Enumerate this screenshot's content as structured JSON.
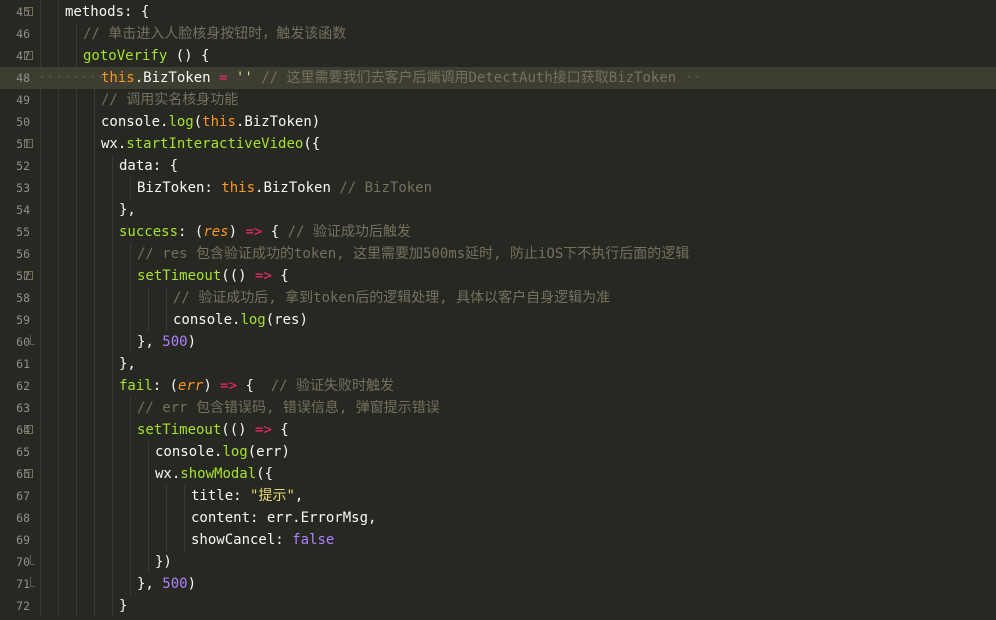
{
  "editor": {
    "theme": "monokai",
    "colors": {
      "background": "#272822",
      "comment": "#75715e",
      "keyword": "#f92672",
      "function": "#a6e22e",
      "string": "#e6db74",
      "number": "#ae81ff",
      "param": "#fd971f"
    },
    "active_line_index": 3,
    "lines": [
      {
        "num": "45",
        "indent": 2,
        "fold": "open",
        "tokens": [
          [
            "pl",
            "methods: {"
          ]
        ]
      },
      {
        "num": "46",
        "indent": 3,
        "tokens": [
          [
            "cm",
            "// 单击进入人脸核身按钮时，触发该函数"
          ]
        ]
      },
      {
        "num": "47",
        "indent": 3,
        "fold": "open",
        "tokens": [
          [
            "fn",
            "gotoVerify"
          ],
          [
            "pl",
            " () {"
          ]
        ]
      },
      {
        "num": "48",
        "indent": 4,
        "dots": "········",
        "tokens": [
          [
            "cs",
            "this"
          ],
          [
            "pl",
            ".BizToken "
          ],
          [
            "kw",
            "="
          ],
          [
            "pl",
            " "
          ],
          [
            "st",
            "''"
          ],
          [
            "pl",
            " "
          ],
          [
            "cm",
            "// 这里需要我们去客户后端调用DetectAuth接口获取BizToken"
          ]
        ],
        "trailing": " ··"
      },
      {
        "num": "49",
        "indent": 4,
        "tokens": [
          [
            "cm",
            "// 调用实名核身功能"
          ]
        ]
      },
      {
        "num": "50",
        "indent": 4,
        "tokens": [
          [
            "pl",
            "console."
          ],
          [
            "fn",
            "log"
          ],
          [
            "pl",
            "("
          ],
          [
            "cs",
            "this"
          ],
          [
            "pl",
            ".BizToken)"
          ]
        ]
      },
      {
        "num": "51",
        "indent": 4,
        "fold": "open",
        "tokens": [
          [
            "pl",
            "wx."
          ],
          [
            "fn",
            "startInteractiveVideo"
          ],
          [
            "pl",
            "({"
          ]
        ]
      },
      {
        "num": "52",
        "indent": 5,
        "tokens": [
          [
            "pl",
            "data: {"
          ]
        ]
      },
      {
        "num": "53",
        "indent": 6,
        "tokens": [
          [
            "pl",
            "BizToken: "
          ],
          [
            "cs",
            "this"
          ],
          [
            "pl",
            ".BizToken "
          ],
          [
            "cm",
            "// BizToken"
          ]
        ]
      },
      {
        "num": "54",
        "indent": 5,
        "tokens": [
          [
            "pl",
            "},"
          ]
        ]
      },
      {
        "num": "55",
        "indent": 5,
        "tokens": [
          [
            "fn",
            "success"
          ],
          [
            "pl",
            ": ("
          ],
          [
            "pm",
            "res"
          ],
          [
            "pl",
            ") "
          ],
          [
            "kw",
            "=>"
          ],
          [
            "pl",
            " { "
          ],
          [
            "cm",
            "// 验证成功后触发"
          ]
        ]
      },
      {
        "num": "56",
        "indent": 6,
        "tokens": [
          [
            "cm",
            "// res 包含验证成功的token, 这里需要加500ms延时, 防止iOS下不执行后面的逻辑"
          ]
        ]
      },
      {
        "num": "57",
        "indent": 6,
        "fold": "open",
        "tokens": [
          [
            "fn",
            "setTimeout"
          ],
          [
            "pl",
            "(() "
          ],
          [
            "kw",
            "=>"
          ],
          [
            "pl",
            " {"
          ]
        ]
      },
      {
        "num": "58",
        "indent": 8,
        "tokens": [
          [
            "cm",
            "// 验证成功后, 拿到token后的逻辑处理, 具体以客户自身逻辑为准"
          ]
        ]
      },
      {
        "num": "59",
        "indent": 8,
        "tokens": [
          [
            "pl",
            "console."
          ],
          [
            "fn",
            "log"
          ],
          [
            "pl",
            "(res)"
          ]
        ]
      },
      {
        "num": "60",
        "indent": 6,
        "foldend": true,
        "tokens": [
          [
            "pl",
            "}, "
          ],
          [
            "nm",
            "500"
          ],
          [
            "pl",
            ")"
          ]
        ]
      },
      {
        "num": "61",
        "indent": 5,
        "tokens": [
          [
            "pl",
            "},"
          ]
        ]
      },
      {
        "num": "62",
        "indent": 5,
        "tokens": [
          [
            "fn",
            "fail"
          ],
          [
            "pl",
            ": ("
          ],
          [
            "pm",
            "err"
          ],
          [
            "pl",
            ") "
          ],
          [
            "kw",
            "=>"
          ],
          [
            "pl",
            " {  "
          ],
          [
            "cm",
            "// 验证失败时触发"
          ]
        ]
      },
      {
        "num": "63",
        "indent": 6,
        "tokens": [
          [
            "cm",
            "// err 包含错误码, 错误信息, 弹窗提示错误"
          ]
        ]
      },
      {
        "num": "64",
        "indent": 6,
        "fold": "open",
        "tokens": [
          [
            "fn",
            "setTimeout"
          ],
          [
            "pl",
            "(() "
          ],
          [
            "kw",
            "=>"
          ],
          [
            "pl",
            " {"
          ]
        ]
      },
      {
        "num": "65",
        "indent": 7,
        "tokens": [
          [
            "pl",
            "console."
          ],
          [
            "fn",
            "log"
          ],
          [
            "pl",
            "(err)"
          ]
        ]
      },
      {
        "num": "66",
        "indent": 7,
        "fold": "open",
        "tokens": [
          [
            "pl",
            "wx."
          ],
          [
            "fn",
            "showModal"
          ],
          [
            "pl",
            "({"
          ]
        ]
      },
      {
        "num": "67",
        "indent": 9,
        "tokens": [
          [
            "pl",
            "title: "
          ],
          [
            "st",
            "\"提示\""
          ],
          [
            "pl",
            ","
          ]
        ]
      },
      {
        "num": "68",
        "indent": 9,
        "tokens": [
          [
            "pl",
            "content: err.ErrorMsg,"
          ]
        ]
      },
      {
        "num": "69",
        "indent": 9,
        "tokens": [
          [
            "pl",
            "showCancel: "
          ],
          [
            "nm",
            "false"
          ]
        ]
      },
      {
        "num": "70",
        "indent": 7,
        "foldend": true,
        "tokens": [
          [
            "pl",
            "})"
          ]
        ]
      },
      {
        "num": "71",
        "indent": 6,
        "foldend": true,
        "tokens": [
          [
            "pl",
            "}, "
          ],
          [
            "nm",
            "500"
          ],
          [
            "pl",
            ")"
          ]
        ]
      },
      {
        "num": "72",
        "indent": 5,
        "tokens": [
          [
            "pl",
            "}"
          ]
        ]
      }
    ]
  }
}
